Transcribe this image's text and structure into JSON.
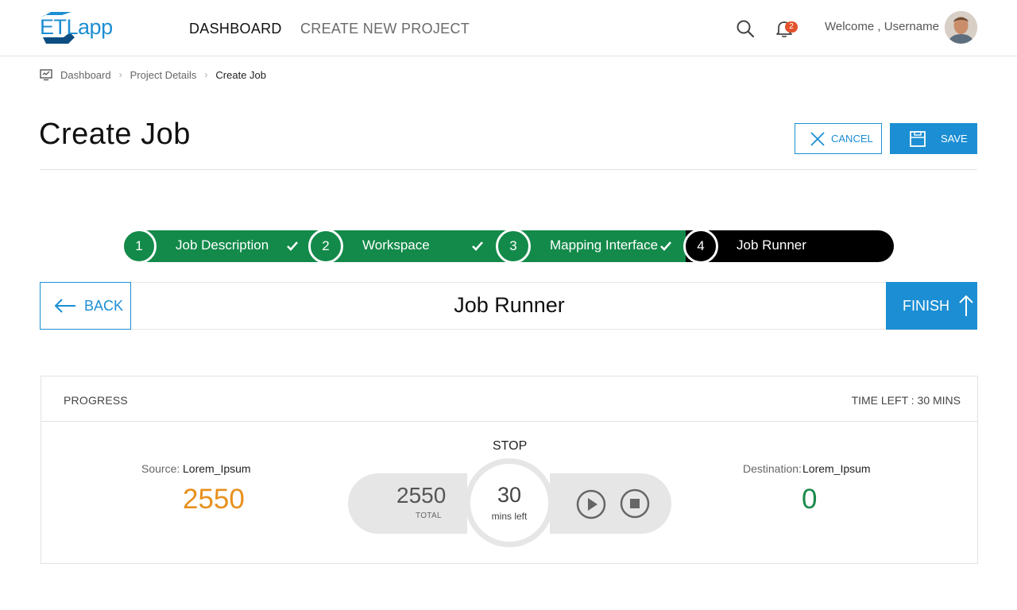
{
  "app": {
    "logo_text_primary": "ETL",
    "logo_text_secondary": "app"
  },
  "nav": {
    "items": [
      {
        "label": "DASHBOARD",
        "active": true
      },
      {
        "label": "CREATE NEW PROJECT",
        "active": false
      }
    ],
    "notification_count": "2",
    "welcome": "Welcome , Username"
  },
  "breadcrumb": [
    {
      "label": "Dashboard"
    },
    {
      "label": "Project Details"
    },
    {
      "label": "Create Job"
    }
  ],
  "page": {
    "title": "Create Job",
    "cancel_label": "CANCEL",
    "save_label": "SAVE"
  },
  "stepper": {
    "steps": [
      {
        "number": "1",
        "label": "Job Description",
        "status": "completed"
      },
      {
        "number": "2",
        "label": "Workspace",
        "status": "completed"
      },
      {
        "number": "3",
        "label": "Mapping Interface",
        "status": "completed"
      },
      {
        "number": "4",
        "label": "Job Runner",
        "status": "active"
      }
    ]
  },
  "action_bar": {
    "back_label": "BACK",
    "title": "Job Runner",
    "finish_label": "FINISH"
  },
  "progress": {
    "label": "PROGRESS",
    "time_left": "TIME LEFT : 30 MINS",
    "source_label": "Source:",
    "source_name": "Lorem_Ipsum",
    "source_count": "2550",
    "destination_label": "Destination:",
    "destination_name": "Lorem_Ipsum",
    "destination_count": "0",
    "stop_label": "STOP",
    "total_value": "2550",
    "total_label": "TOTAL",
    "timer_value": "30",
    "timer_label": "mins left"
  },
  "colors": {
    "accent": "#1c8ed3",
    "step_completed": "#138a4a",
    "step_active": "#000000",
    "source_count": "#e8901c",
    "destination_count": "#1b8a4b",
    "badge": "#e2522b"
  },
  "icons": {
    "search": "search-icon",
    "notifications": "bell-icon",
    "breadcrumb_home": "dashboard-monitor-icon",
    "cancel": "close-icon",
    "save": "save-icon",
    "back": "arrow-left-icon",
    "finish": "arrow-up-icon",
    "play": "play-icon",
    "stop": "stop-icon",
    "step_done": "check-icon"
  }
}
